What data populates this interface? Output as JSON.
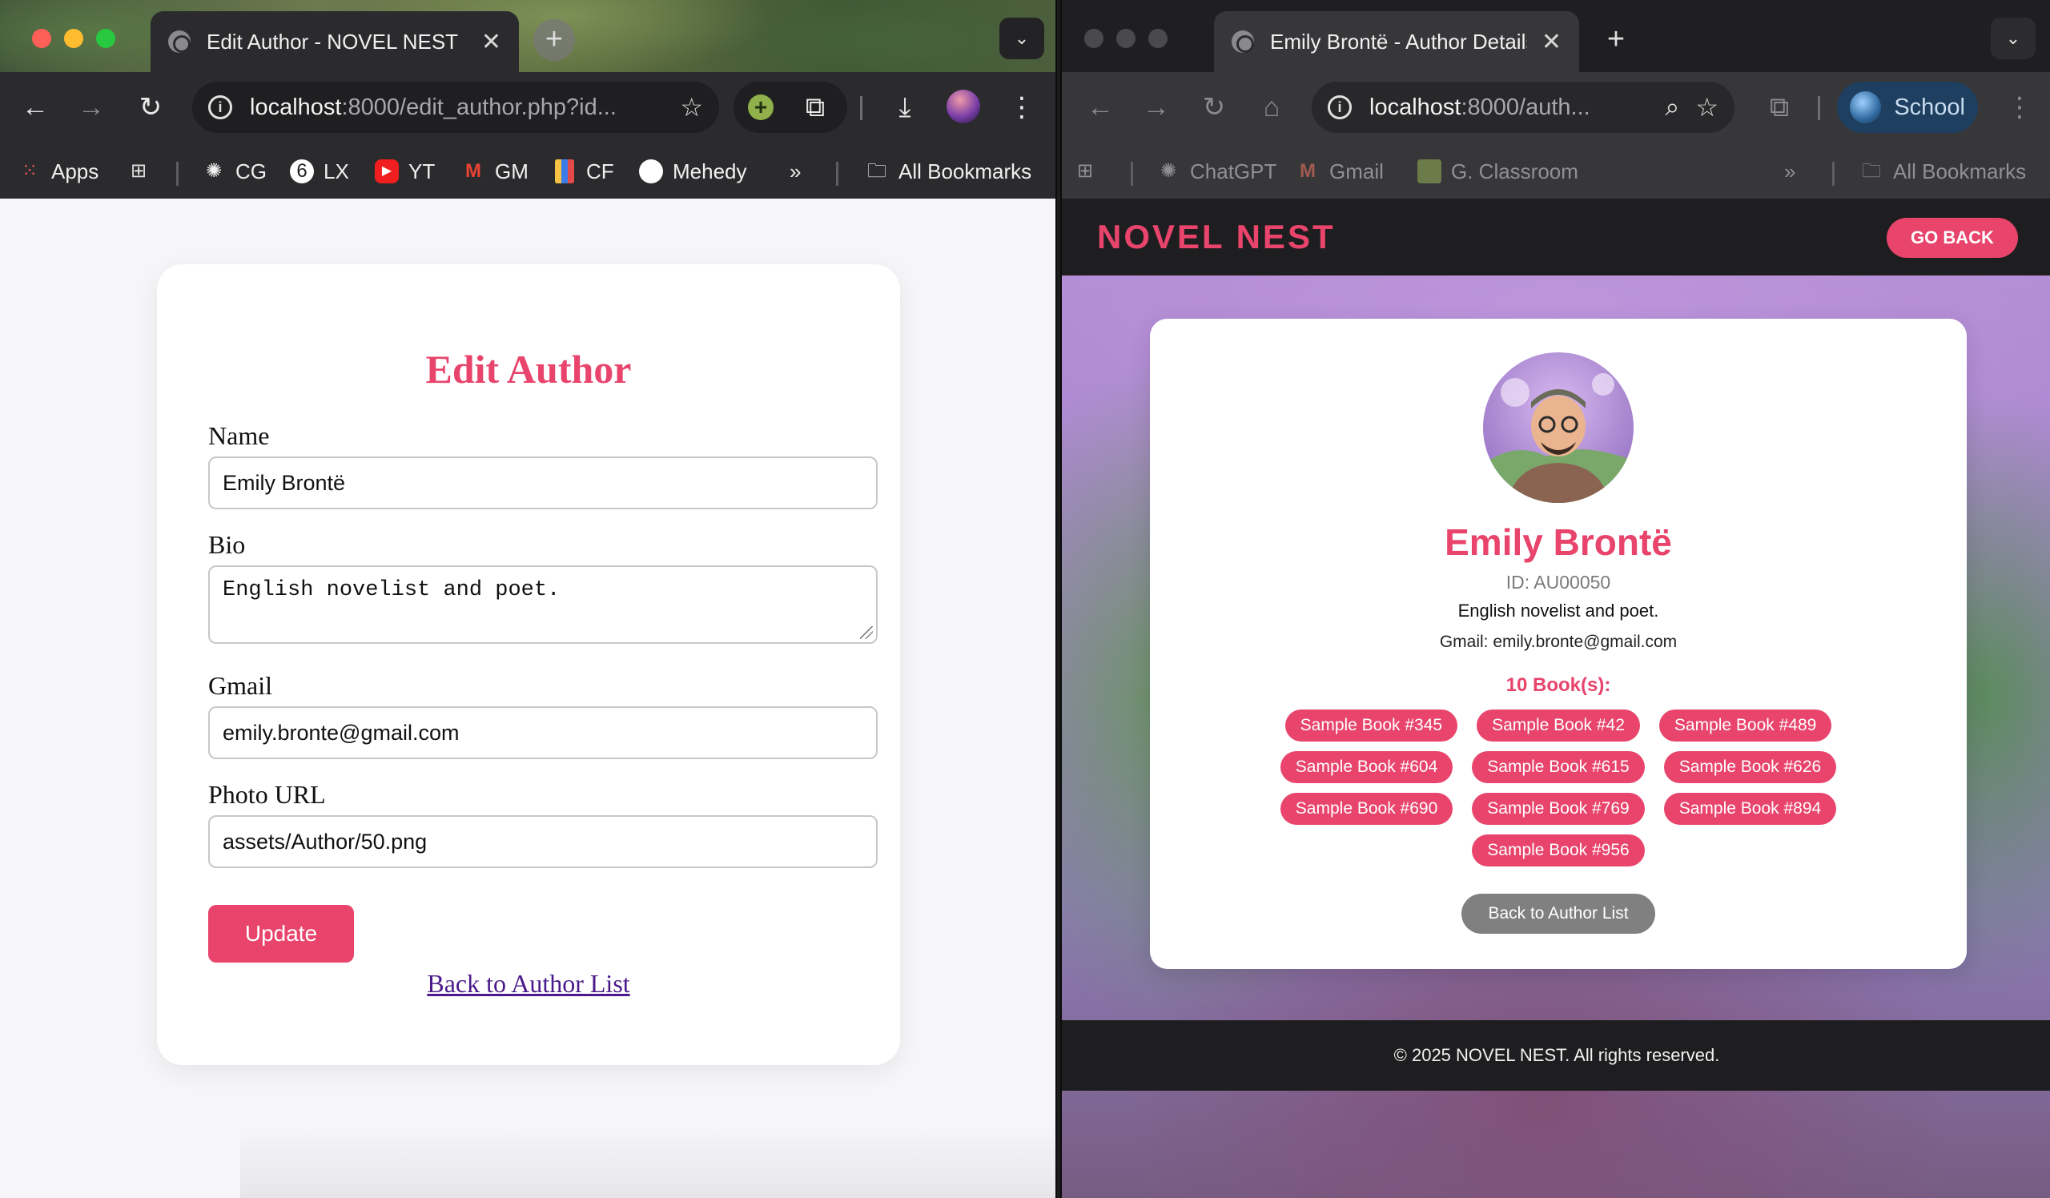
{
  "left_window": {
    "tab_title": "Edit Author - NOVEL NEST",
    "url_host": "localhost",
    "url_path": ":8000/edit_author.php?id...",
    "bookmarks": [
      {
        "label": "Apps",
        "icon": "apps-grid-icon"
      },
      {
        "label": "CG",
        "icon": "chatgpt-icon"
      },
      {
        "label": "LX",
        "icon": "lx-icon"
      },
      {
        "label": "YT",
        "icon": "youtube-icon"
      },
      {
        "label": "GM",
        "icon": "gmail-icon"
      },
      {
        "label": "CF",
        "icon": "codeforces-icon"
      },
      {
        "label": "Mehedy",
        "icon": "github-icon"
      },
      {
        "label": "All Bookmarks",
        "icon": "folder-icon"
      }
    ],
    "page": {
      "title": "Edit Author",
      "name_label": "Name",
      "name_value": "Emily Brontë",
      "bio_label": "Bio",
      "bio_value": "English novelist and poet.",
      "gmail_label": "Gmail",
      "gmail_value": "emily.bronte@gmail.com",
      "photo_label": "Photo URL",
      "photo_value": "assets/Author/50.png",
      "update_label": "Update",
      "back_link": "Back to Author List"
    }
  },
  "right_window": {
    "tab_title": "Emily Brontë - Author Details",
    "url_host": "localhost",
    "url_path": ":8000/auth...",
    "profile": "School",
    "bookmarks": [
      {
        "label": "ChatGPT",
        "icon": "chatgpt-icon"
      },
      {
        "label": "Gmail",
        "icon": "gmail-icon"
      },
      {
        "label": "G. Classroom",
        "icon": "classroom-icon"
      },
      {
        "label": "All Bookmarks",
        "icon": "folder-icon"
      }
    ],
    "page": {
      "brand": "NOVEL NEST",
      "go_back": "GO BACK",
      "author_name": "Emily Brontë",
      "author_id": "ID: AU00050",
      "bio": "English novelist and poet.",
      "gmail": "Gmail: emily.bronte@gmail.com",
      "books_count": "10 Book(s):",
      "books": [
        "Sample Book #345",
        "Sample Book #42",
        "Sample Book #489",
        "Sample Book #604",
        "Sample Book #615",
        "Sample Book #626",
        "Sample Book #690",
        "Sample Book #769",
        "Sample Book #894",
        "Sample Book #956"
      ],
      "back_button": "Back to Author List",
      "footer": "© 2025 NOVEL NEST. All rights reserved."
    }
  },
  "colors": {
    "accent": "#e8446c",
    "dark": "#1e1e20",
    "gray_button": "#808080"
  }
}
